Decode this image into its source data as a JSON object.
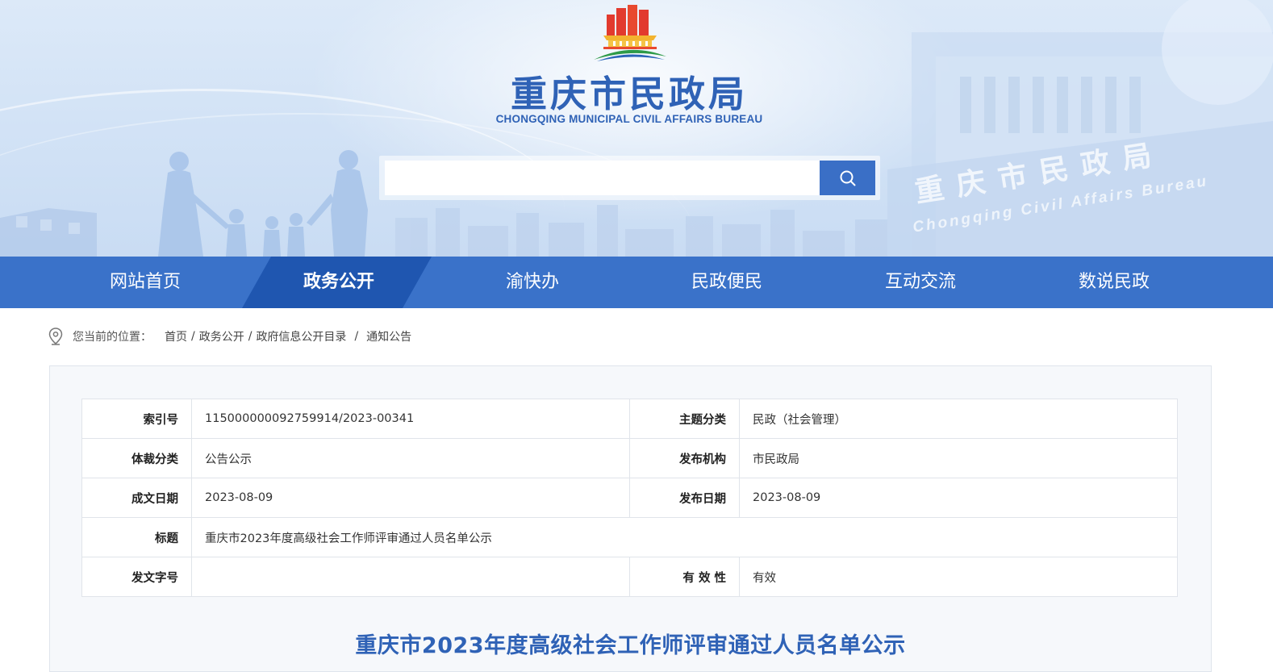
{
  "header": {
    "site_name": "重庆市民政局",
    "site_name_en": "CHONGQING MUNICIPAL CIVIL AFFAIRS BUREAU",
    "backdrop_text_cn": "重庆市民政局",
    "backdrop_text_en": "Chongqing Civil Affairs Bureau",
    "search": {
      "placeholder": "",
      "value": "",
      "button_icon": "search-icon"
    }
  },
  "nav": {
    "items": [
      {
        "label": "网站首页",
        "active": false
      },
      {
        "label": "政务公开",
        "active": true
      },
      {
        "label": "渝快办",
        "active": false
      },
      {
        "label": "民政便民",
        "active": false
      },
      {
        "label": "互动交流",
        "active": false
      },
      {
        "label": "数说民政",
        "active": false
      }
    ]
  },
  "breadcrumb": {
    "icon": "location-pin-icon",
    "label": "您当前的位置：",
    "items": [
      "首页",
      "政务公开",
      "政府信息公开目录",
      "通知公告"
    ]
  },
  "meta": {
    "index_no": {
      "key": "索引号",
      "value": "115000000092759914/2023-00341"
    },
    "topic": {
      "key": "主题分类",
      "value": "民政（社会管理）"
    },
    "genre": {
      "key": "体裁分类",
      "value": "公告公示"
    },
    "publisher": {
      "key": "发布机构",
      "value": "市民政局"
    },
    "created": {
      "key": "成文日期",
      "value": "2023-08-09"
    },
    "published": {
      "key": "发布日期",
      "value": "2023-08-09"
    },
    "title": {
      "key": "标题",
      "value": "重庆市2023年度高级社会工作师评审通过人员名单公示"
    },
    "doc_no": {
      "key": "发文字号",
      "value": ""
    },
    "validity": {
      "key": "有 效 性",
      "value": "有效"
    }
  },
  "article": {
    "title": "重庆市2023年度高级社会工作师评审通过人员名单公示"
  },
  "colors": {
    "brand_blue": "#3a72c9",
    "nav_active": "#1f56b0",
    "title_blue": "#2f62b6"
  }
}
